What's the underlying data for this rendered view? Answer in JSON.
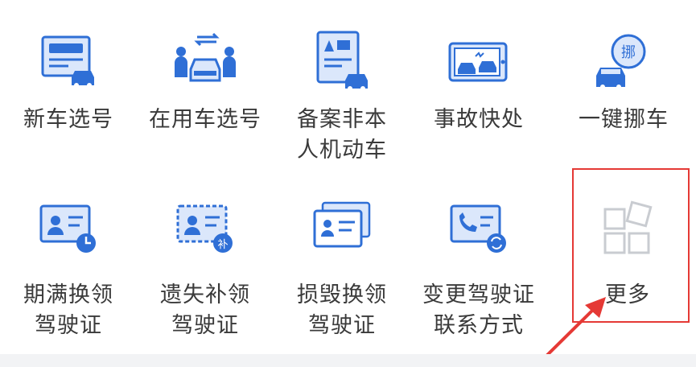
{
  "row1": [
    {
      "label": "新车选号",
      "icon": "new-car-plate-icon"
    },
    {
      "label": "在用车选号",
      "icon": "car-swap-icon"
    },
    {
      "label": "备案非本\n人机动车",
      "icon": "filing-document-icon"
    },
    {
      "label": "事故快处",
      "icon": "accident-icon"
    },
    {
      "label": "一键挪车",
      "icon": "move-car-icon"
    }
  ],
  "row2": [
    {
      "label": "期满换领\n驾驶证",
      "icon": "license-expiry-icon"
    },
    {
      "label": "遗失补领\n驾驶证",
      "icon": "license-lost-icon"
    },
    {
      "label": "损毁换领\n驾驶证",
      "icon": "license-damaged-icon"
    },
    {
      "label": "变更驾驶证\n联系方式",
      "icon": "license-contact-icon"
    },
    {
      "label": "更多",
      "icon": "more-grid-icon"
    }
  ],
  "colors": {
    "primary": "#2f6fd6",
    "light": "#dbe7fb",
    "label": "#3a3a3a",
    "highlight": "#e53935",
    "more_gray": "#c9ccd1"
  }
}
